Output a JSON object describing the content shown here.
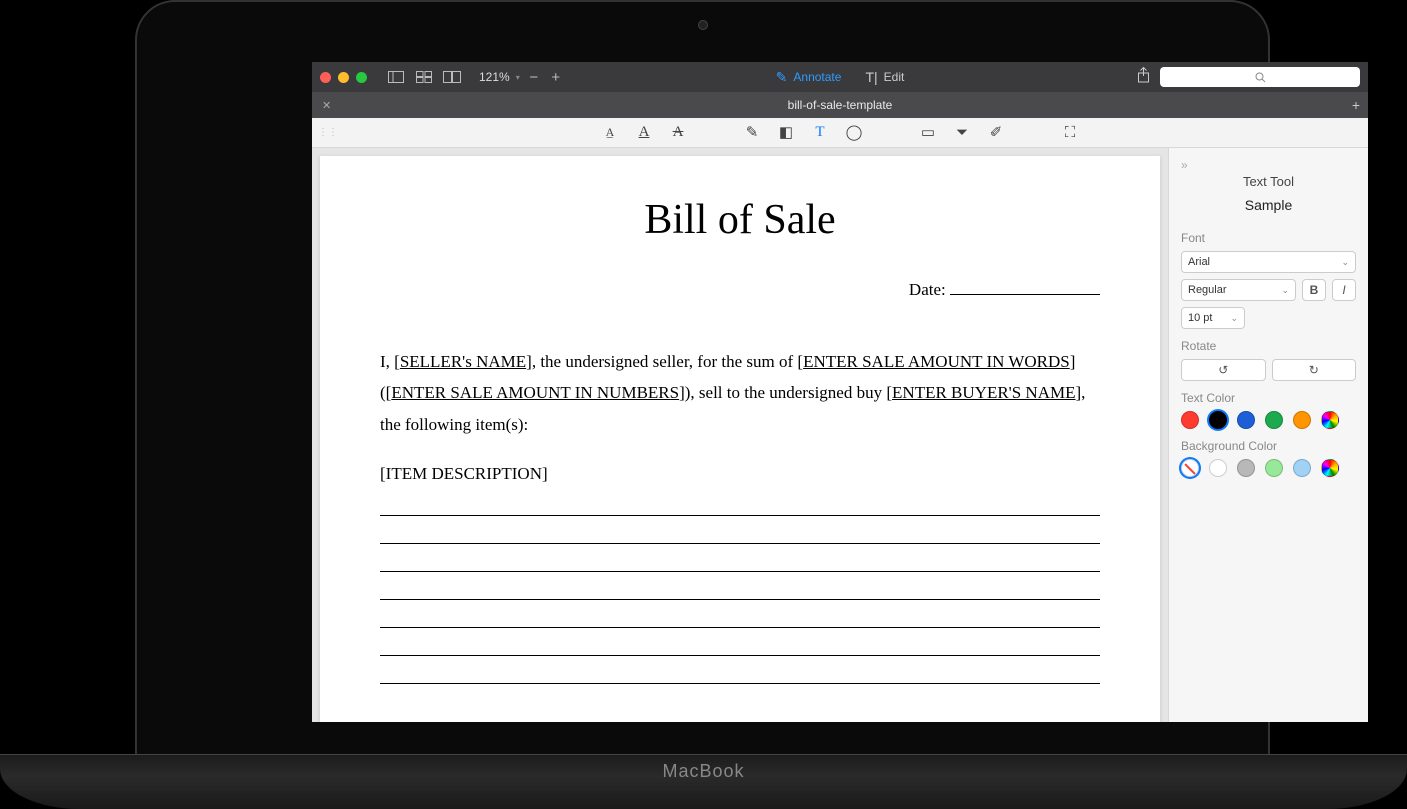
{
  "toolbar": {
    "zoom": "121%",
    "mode_annotate": "Annotate",
    "mode_edit": "Edit",
    "search_placeholder": ""
  },
  "tab": {
    "filename": "bill-of-sale-template"
  },
  "document": {
    "title": "Bill of Sale",
    "date_label": "Date:",
    "para_prefix": "I, [",
    "seller_ph": "SELLER's NAME",
    "para_mid1": "], the undersigned seller, for the sum of [",
    "amount_words_ph": "ENTER SALE AMOUNT IN WORDS",
    "para_mid2": "] ([",
    "amount_num_ph": "ENTER SALE AMOUNT IN NUMBERS",
    "para_mid3": "]), sell to the undersigned buy [",
    "buyer_ph": "ENTER BUYER'S NAME",
    "para_suffix": "], the following item(s):",
    "item_desc": "[ITEM DESCRIPTION]"
  },
  "inspector": {
    "title": "Text Tool",
    "sample": "Sample",
    "font_label": "Font",
    "font_value": "Arial",
    "weight_value": "Regular",
    "bold_label": "B",
    "italic_label": "I",
    "size_value": "10 pt",
    "rotate_label": "Rotate",
    "text_color_label": "Text Color",
    "bg_color_label": "Background Color",
    "text_colors": [
      "#ff3b30",
      "#000000",
      "#1d5fd6",
      "#1da94e",
      "#ff9500"
    ],
    "text_color_selected_index": 1,
    "bg_colors_listed": [
      "#ffffff",
      "#b8b8b8",
      "#98e89a",
      "#9fd2f5"
    ]
  },
  "laptop_label": "MacBook"
}
